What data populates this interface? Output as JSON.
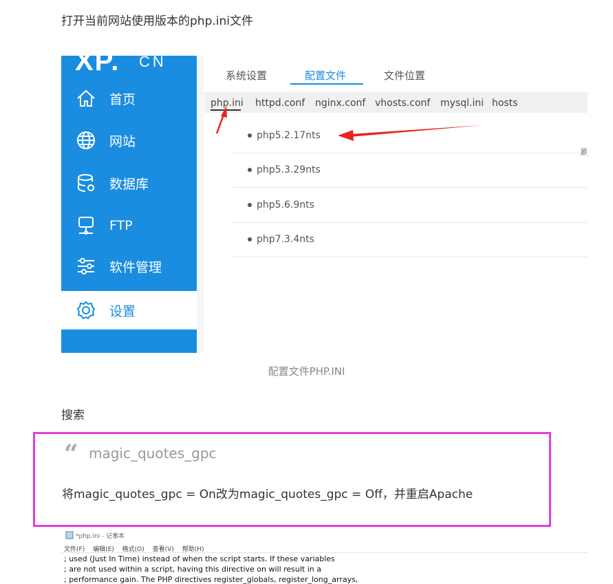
{
  "intro": "打开当前网站使用版本的php.ini文件",
  "shot": {
    "logo": "XP.",
    "logo_cn": "CN",
    "nav": [
      "首页",
      "网站",
      "数据库",
      "FTP",
      "软件管理",
      "设置"
    ],
    "top_tabs": [
      "系统设置",
      "配置文件",
      "文件位置"
    ],
    "sub_tabs": [
      "php.ini",
      "httpd.conf",
      "nginx.conf",
      "vhosts.conf",
      "mysql.ini",
      "hosts"
    ],
    "rows": [
      "php5.2.17nts",
      "php5.3.29nts",
      "php5.6.9nts",
      "php7.3.4nts"
    ],
    "edge_char": "刷",
    "accent": "#1a8de0",
    "arrow_color": "#e8231f"
  },
  "caption": "配置文件PHP.INI",
  "search_label": "搜索",
  "quote": {
    "mark": "“",
    "heading": "magic_quotes_gpc",
    "body": "将magic_quotes_gpc = On改为magic_quotes_gpc = Off，并重启Apache",
    "border_color": "#e23de0"
  },
  "notepad": {
    "title": "*php.ini - 记事本",
    "menu": [
      "文件(F)",
      "编辑(E)",
      "格式(O)",
      "查看(V)",
      "帮助(H)"
    ],
    "lines": [
      "; used (Just In Time) instead of when the script starts. If these variables",
      "; are not used within a script, having this directive on will result in a",
      "; performance gain. The PHP directives register_globals, register_long_arrays,"
    ]
  }
}
